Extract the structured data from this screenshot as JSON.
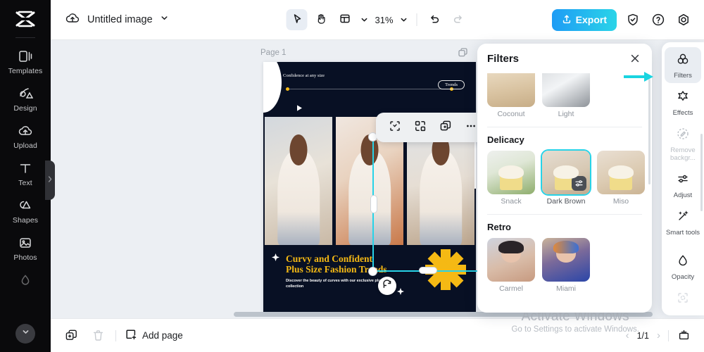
{
  "app": {
    "brand": "capcut-logo",
    "doc_title": "Untitled image",
    "zoom_level": "31%"
  },
  "left_rail": {
    "items": [
      {
        "label": "Templates",
        "icon": "templates-icon"
      },
      {
        "label": "Design",
        "icon": "design-icon"
      },
      {
        "label": "Upload",
        "icon": "upload-cloud-icon"
      },
      {
        "label": "Text",
        "icon": "text-icon"
      },
      {
        "label": "Shapes",
        "icon": "shapes-icon"
      },
      {
        "label": "Photos",
        "icon": "photos-icon"
      }
    ],
    "expand_icon": "chevron-down-icon",
    "collapse_handle_icon": "chevron-right-icon"
  },
  "toolbar": {
    "cloud_icon": "cloud-upload-icon",
    "title_chevron": "chevron-down-icon",
    "select_tool_icon": "cursor-arrow-icon",
    "hand_tool_icon": "hand-icon",
    "layout_tool_icon": "layout-icon",
    "layout_chevron": "chevron-down-icon",
    "zoom_chevron": "chevron-down-icon",
    "undo_icon": "undo-icon",
    "redo_icon": "redo-icon",
    "export_label": "Export",
    "export_icon": "export-upload-icon",
    "shield_icon": "shield-check-icon",
    "help_icon": "question-circle-icon",
    "settings_icon": "gear-icon",
    "export_color": "#1e9cf5"
  },
  "canvas": {
    "page_label": "Page 1",
    "page_duplicate_icon": "duplicate-page-icon",
    "design": {
      "header_text": "Confidence at any size",
      "badge_text": "Trends",
      "title_line1": "Curvy and Confident",
      "title_line2": "Plus Size Fashion Trends",
      "subtitle": "Discover the beauty of curves with our exclusive plus-size collection",
      "title_color": "#f5b914",
      "background_color": "#081024",
      "star_color": "#f5b914"
    },
    "float_toolbar": {
      "crop_icon": "crop-icon",
      "replace_icon": "replace-image-icon",
      "duplicate_icon": "duplicate-icon",
      "more_icon": "more-horizontal-icon"
    },
    "selection": {
      "color": "#27d3e8",
      "rotate_icon": "rotate-icon"
    }
  },
  "filters_panel": {
    "title": "Filters",
    "close_icon": "close-icon",
    "sections": [
      {
        "name": "",
        "items": [
          {
            "label": "Coconut",
            "thumb": "t-coconut",
            "selected": false
          },
          {
            "label": "Light",
            "thumb": "t-light",
            "selected": false
          }
        ]
      },
      {
        "name": "Delicacy",
        "items": [
          {
            "label": "Snack",
            "thumb": "t-snack t-cake",
            "selected": false
          },
          {
            "label": "Dark Brown",
            "thumb": "t-dark t-cake",
            "selected": true
          },
          {
            "label": "Miso",
            "thumb": "t-miso t-cake",
            "selected": false
          }
        ]
      },
      {
        "name": "Retro",
        "items": [
          {
            "label": "Carmel",
            "thumb": "t-carmel t-face",
            "selected": false
          },
          {
            "label": "Miami",
            "thumb": "t-miami t-face",
            "selected": false
          }
        ]
      }
    ],
    "adjust_badge_icon": "sliders-icon",
    "selected_color": "#27d3e8"
  },
  "right_rail": {
    "items": [
      {
        "label": "Filters",
        "icon": "filters-circles-icon",
        "active": true,
        "dim": false
      },
      {
        "label": "Effects",
        "icon": "effects-star-icon",
        "active": false,
        "dim": false
      },
      {
        "label": "Remove backgr...",
        "icon": "remove-background-icon",
        "active": false,
        "dim": true
      },
      {
        "label": "Adjust",
        "icon": "sliders-icon",
        "active": false,
        "dim": false
      },
      {
        "label": "Smart tools",
        "icon": "magic-wand-icon",
        "active": false,
        "dim": false
      },
      {
        "label": "Opacity",
        "icon": "opacity-drop-icon",
        "active": false,
        "dim": false
      }
    ],
    "disabled_tool_icon": "crop-dashed-icon",
    "annotation_arrow_color": "#1ad4e0"
  },
  "bottom_bar": {
    "duplicate_icon": "duplicate-page-icon",
    "delete_icon": "trash-icon",
    "add_page_label": "Add page",
    "add_page_icon": "add-page-icon",
    "prev_icon": "chevron-left-icon",
    "next_icon": "chevron-right-icon",
    "page_count": "1/1",
    "view_icon": "presentation-icon"
  },
  "watermark": {
    "title": "Activate Windows",
    "subtitle": "Go to Settings to activate Windows."
  }
}
